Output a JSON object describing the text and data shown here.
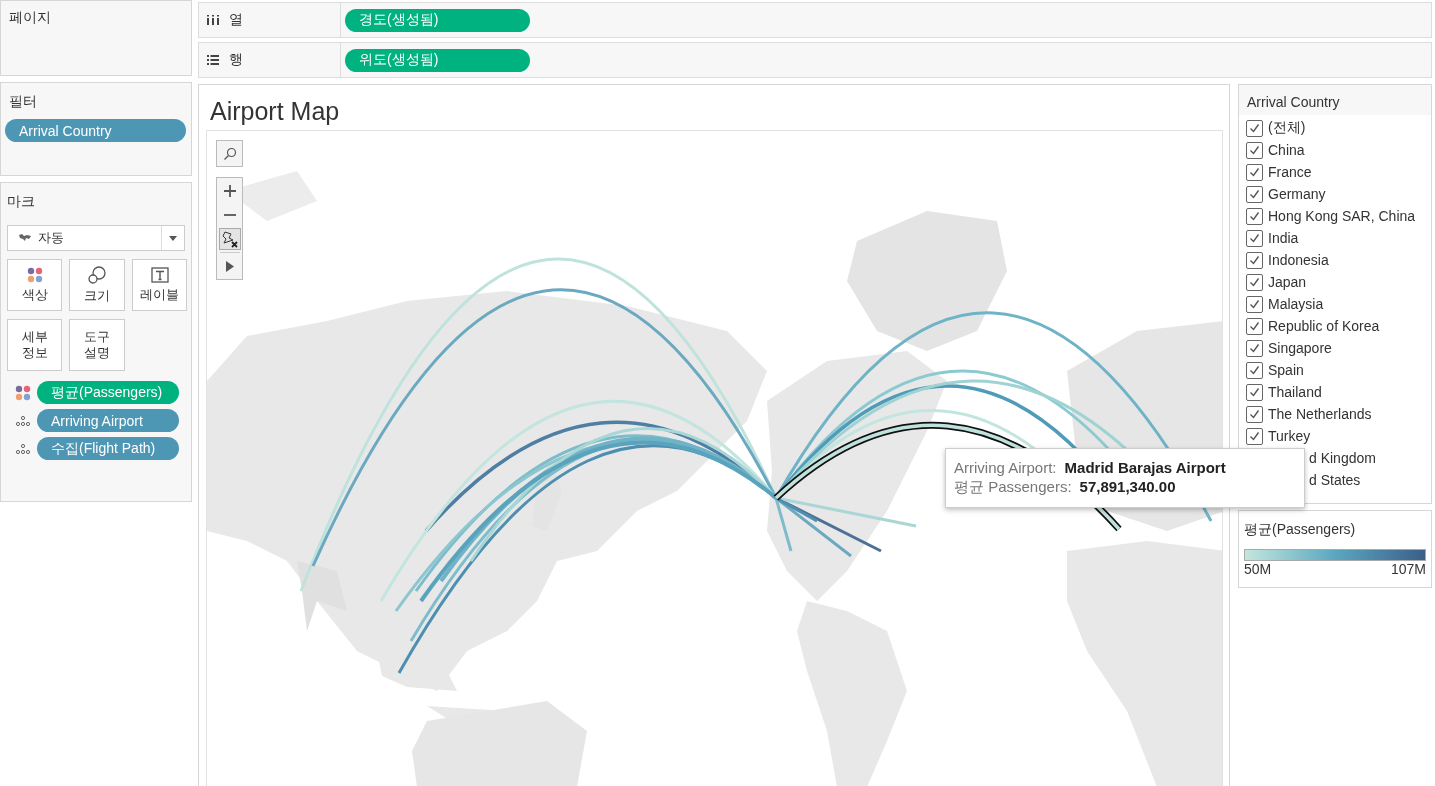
{
  "pages_shelf": {
    "label": "페이지"
  },
  "columns_shelf": {
    "label": "열",
    "pills": [
      {
        "label": "경도(생성됨)",
        "color": "#00b27f"
      }
    ]
  },
  "rows_shelf": {
    "label": "행",
    "pills": [
      {
        "label": "위도(생성됨)",
        "color": "#00b27f"
      }
    ]
  },
  "filters": {
    "label": "필터",
    "pills": [
      {
        "label": "Arrival Country",
        "color": "#4d97b4"
      }
    ]
  },
  "marks": {
    "label": "마크",
    "mark_type": "자동",
    "buttons": [
      {
        "kind": "color",
        "label": "색상"
      },
      {
        "kind": "size",
        "label": "크기"
      },
      {
        "kind": "text",
        "label": "레이블"
      },
      {
        "kind": "detail",
        "label": "세부 정보"
      },
      {
        "kind": "tooltip",
        "label": "도구 설명"
      }
    ],
    "pills": [
      {
        "kind": "color",
        "label": "평균(Passengers)",
        "color": "#00b27f"
      },
      {
        "kind": "detail",
        "label": "Arriving Airport",
        "color": "#4d97b4"
      },
      {
        "kind": "detail",
        "label": "수집(Flight Path)",
        "color": "#4d97b4"
      }
    ]
  },
  "sheet": {
    "title": "Airport Map",
    "tooltip": {
      "rows": [
        {
          "label": "Arriving Airport:",
          "value": "Madrid Barajas Airport"
        },
        {
          "label": "평균 Passengers:",
          "value": "57,891,340.00"
        }
      ]
    }
  },
  "filter_card": {
    "title": "Arrival Country",
    "items": [
      {
        "label": "(전체)",
        "checked": true
      },
      {
        "label": "China",
        "checked": true
      },
      {
        "label": "France",
        "checked": true
      },
      {
        "label": "Germany",
        "checked": true
      },
      {
        "label": "Hong Kong SAR, China",
        "checked": true
      },
      {
        "label": "India",
        "checked": true
      },
      {
        "label": "Indonesia",
        "checked": true
      },
      {
        "label": "Japan",
        "checked": true
      },
      {
        "label": "Malaysia",
        "checked": true
      },
      {
        "label": "Republic of Korea",
        "checked": true
      },
      {
        "label": "Singapore",
        "checked": true
      },
      {
        "label": "Spain",
        "checked": true
      },
      {
        "label": "Thailand",
        "checked": true
      },
      {
        "label": "The Netherlands",
        "checked": true
      },
      {
        "label": "Turkey",
        "checked": true
      },
      {
        "label": "d Kingdom"
      },
      {
        "label": "d States"
      }
    ]
  },
  "legend": {
    "title": "평균(Passengers)",
    "min": "50M",
    "max": "107M"
  }
}
